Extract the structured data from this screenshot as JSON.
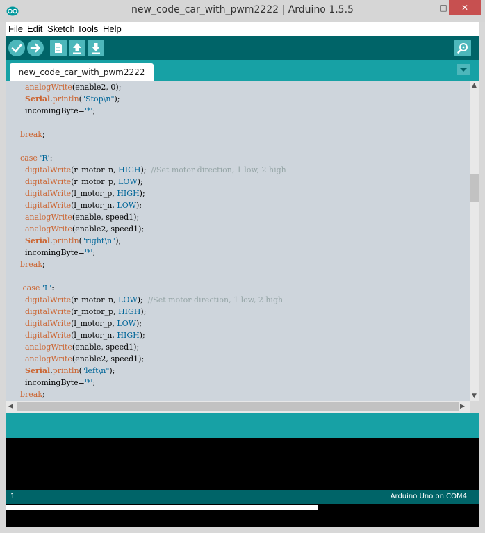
{
  "window": {
    "title": "new_code_car_with_pwm2222 | Arduino 1.5.5",
    "min_glyph": "—",
    "max_glyph": "□",
    "close_glyph": "✕"
  },
  "menu": [
    "File",
    "Edit",
    "Sketch",
    "Tools",
    "Help"
  ],
  "toolbar": {
    "buttons": [
      {
        "name": "verify",
        "icon": "checkmark-icon"
      },
      {
        "name": "upload",
        "icon": "arrow-right-icon"
      },
      {
        "name": "new",
        "icon": "new-file-icon"
      },
      {
        "name": "open",
        "icon": "arrow-up-icon"
      },
      {
        "name": "save",
        "icon": "arrow-down-icon"
      },
      {
        "name": "serial-monitor",
        "icon": "magnifier-icon"
      }
    ]
  },
  "tabs": [
    {
      "label": "new_code_car_with_pwm2222"
    }
  ],
  "code_lines": [
    [
      [
        "    ",
        "black"
      ],
      [
        "analogWrite",
        "kw-orange"
      ],
      [
        "(enable2, 0);",
        "black"
      ]
    ],
    [
      [
        "    ",
        "black"
      ],
      [
        "Serial",
        "serial"
      ],
      [
        ".",
        "black"
      ],
      [
        "println",
        "kw-orange"
      ],
      [
        "(",
        "black"
      ],
      [
        "\"Stop\\n\"",
        "str"
      ],
      [
        ");",
        "black"
      ]
    ],
    [
      [
        "    incomingByte=",
        "black"
      ],
      [
        "'*'",
        "str"
      ],
      [
        ";",
        "black"
      ]
    ],
    [
      [
        "",
        "black"
      ]
    ],
    [
      [
        "  ",
        "black"
      ],
      [
        "break",
        "kw-orange"
      ],
      [
        ";",
        "black"
      ]
    ],
    [
      [
        "",
        "black"
      ]
    ],
    [
      [
        "  ",
        "black"
      ],
      [
        "case",
        "kw-orange"
      ],
      [
        " ",
        "black"
      ],
      [
        "'R'",
        "str"
      ],
      [
        ":",
        "black"
      ]
    ],
    [
      [
        "    ",
        "black"
      ],
      [
        "digitalWrite",
        "kw-orange"
      ],
      [
        "(r_motor_n, ",
        "black"
      ],
      [
        "HIGH",
        "kw-blue"
      ],
      [
        ");  ",
        "black"
      ],
      [
        "//Set motor direction, 1 low, 2 high",
        "cmt"
      ]
    ],
    [
      [
        "    ",
        "black"
      ],
      [
        "digitalWrite",
        "kw-orange"
      ],
      [
        "(r_motor_p, ",
        "black"
      ],
      [
        "LOW",
        "kw-blue"
      ],
      [
        ");",
        "black"
      ]
    ],
    [
      [
        "    ",
        "black"
      ],
      [
        "digitalWrite",
        "kw-orange"
      ],
      [
        "(l_motor_p, ",
        "black"
      ],
      [
        "HIGH",
        "kw-blue"
      ],
      [
        ");",
        "black"
      ]
    ],
    [
      [
        "    ",
        "black"
      ],
      [
        "digitalWrite",
        "kw-orange"
      ],
      [
        "(l_motor_n, ",
        "black"
      ],
      [
        "LOW",
        "kw-blue"
      ],
      [
        ");",
        "black"
      ]
    ],
    [
      [
        "    ",
        "black"
      ],
      [
        "analogWrite",
        "kw-orange"
      ],
      [
        "(enable, speed1);",
        "black"
      ]
    ],
    [
      [
        "    ",
        "black"
      ],
      [
        "analogWrite",
        "kw-orange"
      ],
      [
        "(enable2, speed1);",
        "black"
      ]
    ],
    [
      [
        "    ",
        "black"
      ],
      [
        "Serial",
        "serial"
      ],
      [
        ".",
        "black"
      ],
      [
        "println",
        "kw-orange"
      ],
      [
        "(",
        "black"
      ],
      [
        "\"right\\n\"",
        "str"
      ],
      [
        ");",
        "black"
      ]
    ],
    [
      [
        "    incomingByte=",
        "black"
      ],
      [
        "'*'",
        "str"
      ],
      [
        ";",
        "black"
      ]
    ],
    [
      [
        "  ",
        "black"
      ],
      [
        "break",
        "kw-orange"
      ],
      [
        ";",
        "black"
      ]
    ],
    [
      [
        "",
        "black"
      ]
    ],
    [
      [
        "   ",
        "black"
      ],
      [
        "case",
        "kw-orange"
      ],
      [
        " ",
        "black"
      ],
      [
        "'L'",
        "str"
      ],
      [
        ":",
        "black"
      ]
    ],
    [
      [
        "    ",
        "black"
      ],
      [
        "digitalWrite",
        "kw-orange"
      ],
      [
        "(r_motor_n, ",
        "black"
      ],
      [
        "LOW",
        "kw-blue"
      ],
      [
        ");  ",
        "black"
      ],
      [
        "//Set motor direction, 1 low, 2 high",
        "cmt"
      ]
    ],
    [
      [
        "    ",
        "black"
      ],
      [
        "digitalWrite",
        "kw-orange"
      ],
      [
        "(r_motor_p, ",
        "black"
      ],
      [
        "HIGH",
        "kw-blue"
      ],
      [
        ");",
        "black"
      ]
    ],
    [
      [
        "    ",
        "black"
      ],
      [
        "digitalWrite",
        "kw-orange"
      ],
      [
        "(l_motor_p, ",
        "black"
      ],
      [
        "LOW",
        "kw-blue"
      ],
      [
        ");",
        "black"
      ]
    ],
    [
      [
        "    ",
        "black"
      ],
      [
        "digitalWrite",
        "kw-orange"
      ],
      [
        "(l_motor_n, ",
        "black"
      ],
      [
        "HIGH",
        "kw-blue"
      ],
      [
        ");",
        "black"
      ]
    ],
    [
      [
        "    ",
        "black"
      ],
      [
        "analogWrite",
        "kw-orange"
      ],
      [
        "(enable, speed1);",
        "black"
      ]
    ],
    [
      [
        "    ",
        "black"
      ],
      [
        "analogWrite",
        "kw-orange"
      ],
      [
        "(enable2, speed1);",
        "black"
      ]
    ],
    [
      [
        "    ",
        "black"
      ],
      [
        "Serial",
        "serial"
      ],
      [
        ".",
        "black"
      ],
      [
        "println",
        "kw-orange"
      ],
      [
        "(",
        "black"
      ],
      [
        "\"left\\n\"",
        "str"
      ],
      [
        ");",
        "black"
      ]
    ],
    [
      [
        "    incomingByte=",
        "black"
      ],
      [
        "'*'",
        "str"
      ],
      [
        ";",
        "black"
      ]
    ],
    [
      [
        "  ",
        "black"
      ],
      [
        "break",
        "kw-orange"
      ],
      [
        ";",
        "black"
      ]
    ]
  ],
  "footer": {
    "line_number": "1",
    "board": "Arduino Uno on COM4"
  },
  "progress": {
    "fraction": 0.66
  },
  "colors": {
    "toolbar": "#006468",
    "tabbar": "#17a1a5",
    "editor_bg": "#ced5dc",
    "keyword": "#cc6633",
    "constant": "#006699"
  }
}
